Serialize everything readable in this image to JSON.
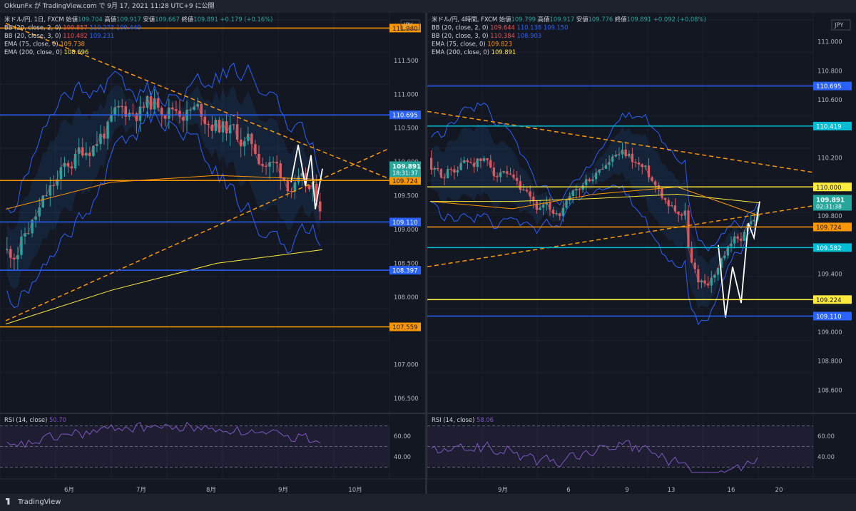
{
  "header": {
    "publish_line": "OkkunFx が TradingView.com で 9月 17, 2021 11:28 UTC+9 に公開"
  },
  "footer": {
    "brand": "TradingView"
  },
  "colors": {
    "bg": "#131722",
    "up": "#26a69a",
    "down": "#ef5350",
    "orange": "#ff9800",
    "blue": "#2962ff",
    "teal": "#00bcd4",
    "yellow": "#ffeb3b",
    "rsi": "#7e57c2"
  },
  "left": {
    "currency": "JPY",
    "legend": [
      {
        "parts": [
          {
            "t": "米ドル/円, 1日, FXCM ",
            "c": "#d1d4dc"
          },
          {
            "t": "始値",
            "c": "#d1d4dc"
          },
          {
            "t": "109.704 ",
            "c": "#26a69a"
          },
          {
            "t": "高値",
            "c": "#d1d4dc"
          },
          {
            "t": "109.917 ",
            "c": "#26a69a"
          },
          {
            "t": "安値",
            "c": "#d1d4dc"
          },
          {
            "t": "109.667 ",
            "c": "#26a69a"
          },
          {
            "t": "終値",
            "c": "#d1d4dc"
          },
          {
            "t": "109.891 +0.179 (+0.16%)",
            "c": "#26a69a"
          }
        ]
      },
      {
        "parts": [
          {
            "t": "BB (20, close, 2, 0) ",
            "c": "#d1d4dc"
          },
          {
            "t": "109.857 ",
            "c": "#ef5350"
          },
          {
            "t": "110.273 ",
            "c": "#2962ff"
          },
          {
            "t": "109.440",
            "c": "#2962ff"
          }
        ]
      },
      {
        "parts": [
          {
            "t": "BB (20, close, 3, 0) ",
            "c": "#d1d4dc"
          },
          {
            "t": "110.482 ",
            "c": "#ef5350"
          },
          {
            "t": "109.231",
            "c": "#2962ff"
          }
        ]
      },
      {
        "parts": [
          {
            "t": "EMA (75, close, 0) ",
            "c": "#d1d4dc"
          },
          {
            "t": "109.738",
            "c": "#ff9800"
          }
        ]
      },
      {
        "parts": [
          {
            "t": "EMA (200, close, 0) ",
            "c": "#d1d4dc"
          },
          {
            "t": "108.696",
            "c": "#ffeb3b"
          }
        ]
      }
    ],
    "y_ticks": [
      "111.500",
      "111.000",
      "110.500",
      "110.000",
      "109.500",
      "109.000",
      "108.500",
      "108.000",
      "107.000",
      "106.500"
    ],
    "y_top_label": "112.000",
    "x_ticks": [
      "6月",
      "7月",
      "8月",
      "9月",
      "10月"
    ],
    "levels": [
      {
        "v": "111.980",
        "color": "#ff9800"
      },
      {
        "v": "110.695",
        "color": "#2962ff"
      },
      {
        "v": "109.724",
        "color": "#ff9800"
      },
      {
        "v": "109.110",
        "color": "#2962ff"
      },
      {
        "v": "108.397",
        "color": "#2962ff"
      },
      {
        "v": "107.559",
        "color": "#ff9800"
      }
    ],
    "last_price": "109.891",
    "countdown": "18:31:37",
    "rsi_label": "RSI (14, close)",
    "rsi_value": "50.70",
    "rsi_ticks": [
      "60.00",
      "40.00"
    ]
  },
  "right": {
    "currency": "JPY",
    "legend": [
      {
        "parts": [
          {
            "t": "米ドル/円, 4時間, FXCM ",
            "c": "#d1d4dc"
          },
          {
            "t": "始値",
            "c": "#d1d4dc"
          },
          {
            "t": "109.799 ",
            "c": "#26a69a"
          },
          {
            "t": "高値",
            "c": "#d1d4dc"
          },
          {
            "t": "109.917 ",
            "c": "#26a69a"
          },
          {
            "t": "安値",
            "c": "#d1d4dc"
          },
          {
            "t": "109.776 ",
            "c": "#26a69a"
          },
          {
            "t": "終値",
            "c": "#d1d4dc"
          },
          {
            "t": "109.891 +0.092 (+0.08%)",
            "c": "#26a69a"
          }
        ]
      },
      {
        "parts": [
          {
            "t": "BB (20, close, 2, 0) ",
            "c": "#d1d4dc"
          },
          {
            "t": "109.644 ",
            "c": "#ef5350"
          },
          {
            "t": "110.138 ",
            "c": "#2962ff"
          },
          {
            "t": "109.150",
            "c": "#2962ff"
          }
        ]
      },
      {
        "parts": [
          {
            "t": "BB (20, close, 3, 0) ",
            "c": "#d1d4dc"
          },
          {
            "t": "110.384 ",
            "c": "#ef5350"
          },
          {
            "t": "108.903",
            "c": "#2962ff"
          }
        ]
      },
      {
        "parts": [
          {
            "t": "EMA (75, close, 0) ",
            "c": "#d1d4dc"
          },
          {
            "t": "109.823",
            "c": "#ff9800"
          }
        ]
      },
      {
        "parts": [
          {
            "t": "EMA (200, close, 0) ",
            "c": "#d1d4dc"
          },
          {
            "t": "109.891",
            "c": "#ffeb3b"
          }
        ]
      }
    ],
    "y_ticks": [
      "111.000",
      "110.800",
      "110.600",
      "110.200",
      "109.800",
      "109.400",
      "109.000",
      "108.800",
      "108.600"
    ],
    "x_ticks": [
      "9月",
      "6",
      "9",
      "13",
      "16",
      "20"
    ],
    "levels": [
      {
        "v": "110.695",
        "color": "#2962ff"
      },
      {
        "v": "110.419",
        "color": "#00bcd4"
      },
      {
        "v": "110.000",
        "color": "#ffeb3b"
      },
      {
        "v": "109.724",
        "color": "#ff9800"
      },
      {
        "v": "109.582",
        "color": "#00bcd4"
      },
      {
        "v": "109.224",
        "color": "#ffeb3b"
      },
      {
        "v": "109.110",
        "color": "#2962ff"
      }
    ],
    "last_price": "109.891",
    "countdown": "02:31:38",
    "rsi_label": "RSI (14, close)",
    "rsi_value": "58.06",
    "rsi_ticks": [
      "60.00",
      "40.00"
    ]
  },
  "chart_data": [
    {
      "type": "line",
      "title": "米ドル/円, 1日, FXCM",
      "ylim": [
        106.3,
        112.1
      ],
      "x": [
        "6月",
        "7月",
        "8月",
        "9月",
        "10月"
      ],
      "series": [
        {
          "name": "EMA (75, close, 0)",
          "values": [
            109.3,
            109.7,
            109.8,
            109.74
          ]
        },
        {
          "name": "EMA (200, close, 0)",
          "values": [
            107.6,
            108.1,
            108.5,
            108.7
          ]
        }
      ],
      "levels": [
        111.98,
        110.695,
        109.724,
        109.11,
        108.397,
        107.559
      ],
      "last": 109.891
    },
    {
      "type": "line",
      "title": "米ドル/円, 4時間, FXCM",
      "ylim": [
        108.45,
        111.15
      ],
      "x": [
        "9月",
        "6",
        "9",
        "13",
        "16",
        "20"
      ],
      "series": [
        {
          "name": "EMA (75, close, 0)",
          "values": [
            109.9,
            109.85,
            109.95,
            110.0,
            109.8
          ]
        },
        {
          "name": "EMA (200, close, 0)",
          "values": [
            109.9,
            109.9,
            109.92,
            109.95,
            109.89
          ]
        }
      ],
      "levels": [
        110.695,
        110.419,
        110.0,
        109.724,
        109.582,
        109.224,
        109.11
      ],
      "last": 109.891
    }
  ]
}
